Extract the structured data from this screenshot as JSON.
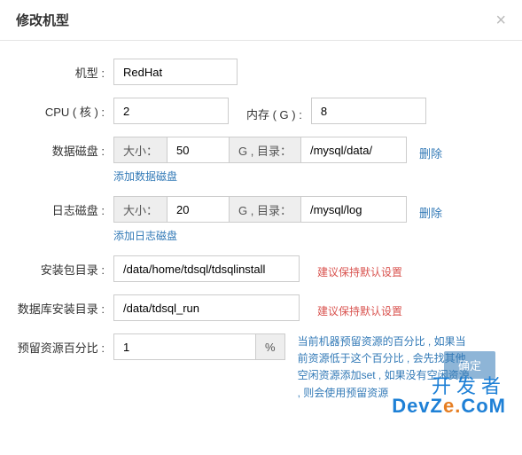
{
  "header": {
    "title": "修改机型",
    "close": "×"
  },
  "form": {
    "model": {
      "label": "机型 :",
      "value": "RedHat"
    },
    "cpu": {
      "label": "CPU ( 核 ) :",
      "value": "2"
    },
    "mem": {
      "label": "内存 ( G ) :",
      "value": "8"
    },
    "dataDisk": {
      "label": "数据磁盘 :",
      "sizeLabel": "大小：",
      "sizeValue": "50",
      "dirLabel": "G , 目录：",
      "dirValue": "/mysql/data/",
      "delete": "删除",
      "addLink": "添加数据磁盘"
    },
    "logDisk": {
      "label": "日志磁盘 :",
      "sizeLabel": "大小：",
      "sizeValue": "20",
      "dirLabel": "G , 目录：",
      "dirValue": "/mysql/log",
      "delete": "删除",
      "addLink": "添加日志磁盘"
    },
    "installDir": {
      "label": "安装包目录 :",
      "value": "/data/home/tdsql/tdsqlinstall",
      "hint": "建议保持默认设置"
    },
    "dbInstallDir": {
      "label": "数据库安装目录 :",
      "value": "/data/tdsql_run",
      "hint": "建议保持默认设置"
    },
    "reservePct": {
      "label": "预留资源百分比 :",
      "value": "1",
      "unit": "%",
      "hint": "当前机器预留资源的百分比 , 如果当前资源低于这个百分比 , 会先找其他空闲资源添加set , 如果没有空闲资源 , 则会使用预留资源"
    }
  },
  "footer": {
    "confirm": "确定"
  },
  "watermark": {
    "top": "开发者",
    "devz": "DevZ",
    "dot": "e.",
    "com": "CoM"
  }
}
